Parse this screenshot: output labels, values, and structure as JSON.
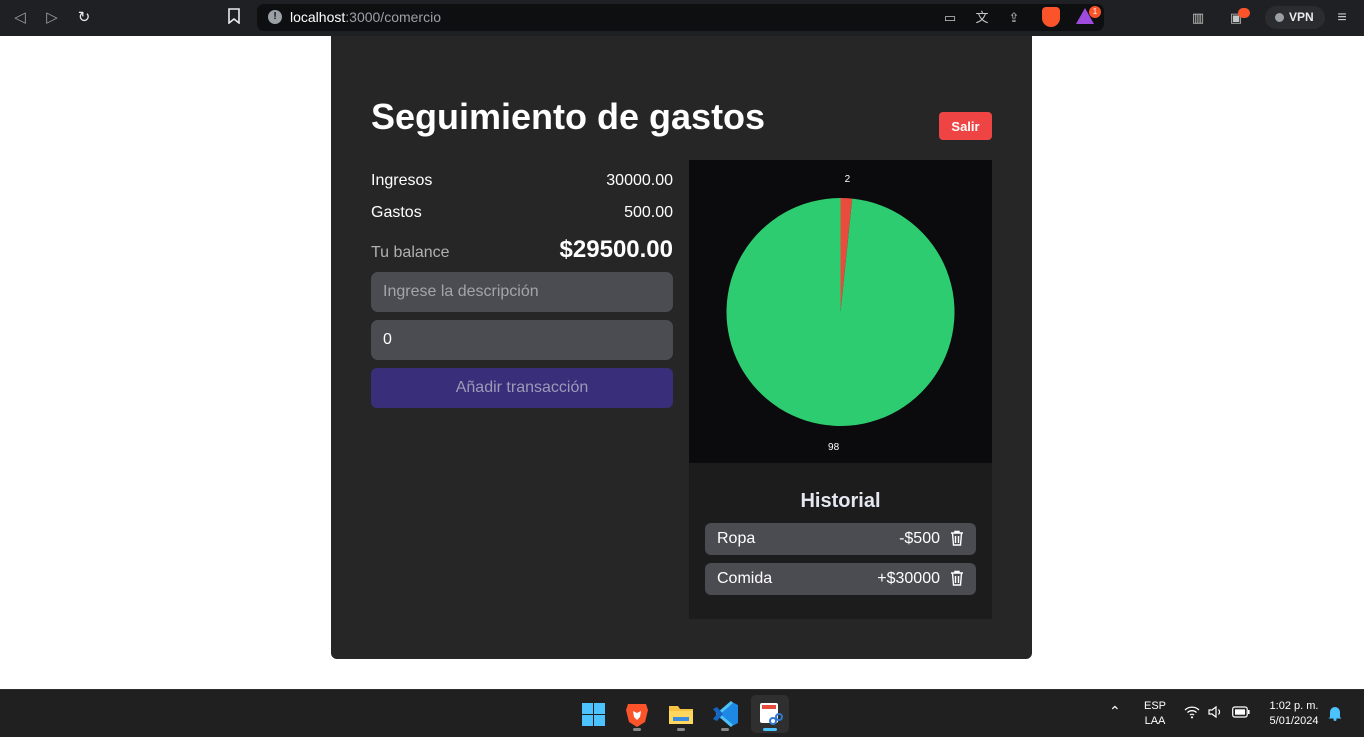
{
  "browser": {
    "url_host": "localhost",
    "url_path": ":3000/comercio",
    "rewards_badge": "1",
    "vpn_label": "VPN"
  },
  "app": {
    "title": "Seguimiento de gastos",
    "logout_label": "Salir",
    "summary": {
      "income_label": "Ingresos",
      "income_value": "30000.00",
      "expense_label": "Gastos",
      "expense_value": "500.00",
      "balance_label": "Tu balance",
      "balance_value": "$29500.00"
    },
    "form": {
      "description_placeholder": "Ingrese la descripción",
      "amount_value": "0",
      "submit_label": "Añadir transacción"
    },
    "history": {
      "title": "Historial",
      "items": [
        {
          "description": "Ropa",
          "amount": "-$500"
        },
        {
          "description": "Comida",
          "amount": "+$30000"
        }
      ]
    }
  },
  "chart_data": {
    "type": "pie",
    "slices": [
      {
        "label": "",
        "value": 500,
        "color": "#e74c3c"
      },
      {
        "label": "",
        "value": 30000,
        "color": "#2ecc71"
      }
    ],
    "data_labels": [
      "2",
      "98"
    ]
  },
  "taskbar": {
    "lang": "ESP",
    "layout": "LAA",
    "time": "1:02 p. m.",
    "date": "5/01/2024"
  }
}
